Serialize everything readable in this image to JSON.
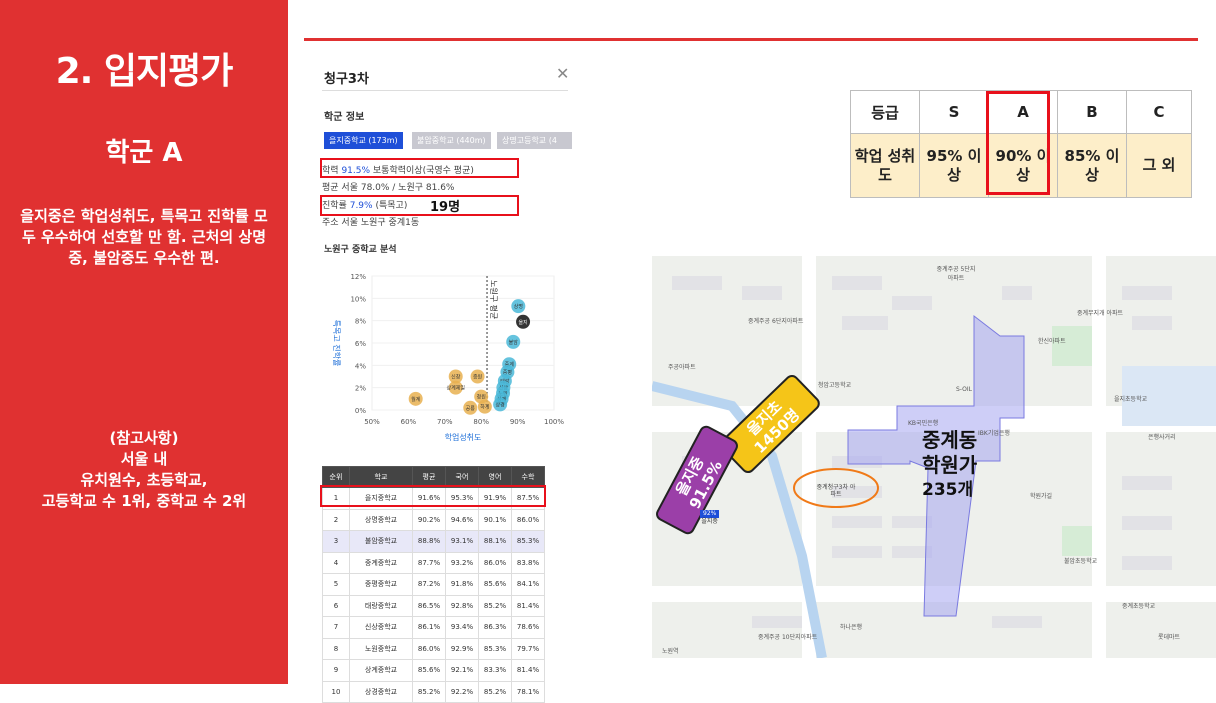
{
  "left": {
    "title": "2. 입지평가",
    "subtitle": "학군 A",
    "desc": "을지중은 학업성취도, 특목고 진학률 모두 우수하여 선호할 만 함. 근처의 상명중, 불암중도 우수한 편.",
    "ref_title": "(참고사항)",
    "ref_lines": [
      "서울 내",
      "유치원수, 초등학교,",
      "고등학교 수 1위, 중학교 수 2위"
    ]
  },
  "colors": {
    "accent_red": "#e03131",
    "tab_blue": "#1e4fd8",
    "highlight_red": "#e8101b",
    "cream": "#fdeec9",
    "purple": "#9b3fa8",
    "yellow": "#f5c518",
    "academy_zone": "#a6a6f0"
  },
  "panel": {
    "title": "청구3차",
    "section_school": "학군 정보",
    "tabs": [
      "을지중학교 (173m)",
      "불암중학교 (440m)",
      "상명고등학교 (4"
    ],
    "achievement_label": "학력",
    "achievement_value": "91.5%",
    "achievement_suffix": "보통학력이상(국영수 평균)",
    "avg_line": "평균 서울 78.0% / 노원구 81.6%",
    "advance_label": "진학률",
    "advance_value": "7.9%",
    "advance_suffix": "(특목고)",
    "advance_note": "19명",
    "address": "주소 서울 노원구 중계1동",
    "section_analysis": "노원구 중학교 분석"
  },
  "chart_data": {
    "type": "scatter",
    "title": "",
    "xlabel": "학업성취도",
    "ylabel": "특목고 진학률",
    "xlim": [
      50,
      100
    ],
    "ylim": [
      0,
      12
    ],
    "x_ticks": [
      "50%",
      "60%",
      "70%",
      "80%",
      "90%",
      "100%"
    ],
    "y_ticks": [
      "0%",
      "2%",
      "4%",
      "6%",
      "8%",
      "10%",
      "12%"
    ],
    "reference_line": {
      "x": 81.6,
      "label": "노원구 평균"
    },
    "points": [
      {
        "label": "을지",
        "x": 91.5,
        "y": 7.9,
        "highlight": true
      },
      {
        "label": "상명",
        "x": 90.2,
        "y": 9.3
      },
      {
        "label": "불암",
        "x": 88.8,
        "y": 6.1
      },
      {
        "label": "중계",
        "x": 87.7,
        "y": 4.1
      },
      {
        "label": "중평",
        "x": 87.2,
        "y": 3.4
      },
      {
        "label": "태랑",
        "x": 86.5,
        "y": 2.6
      },
      {
        "label": "신상",
        "x": 86.1,
        "y": 2.0
      },
      {
        "label": "노원",
        "x": 86.0,
        "y": 1.5
      },
      {
        "label": "상계",
        "x": 85.6,
        "y": 1.0
      },
      {
        "label": "상경",
        "x": 85.2,
        "y": 0.5
      },
      {
        "label": "신창",
        "x": 73,
        "y": 3.0
      },
      {
        "label": "상계제일",
        "x": 73,
        "y": 2.0
      },
      {
        "label": "월계",
        "x": 62,
        "y": 1.0
      },
      {
        "label": "중원",
        "x": 79,
        "y": 3.0
      },
      {
        "label": "공릉",
        "x": 77,
        "y": 0.2
      },
      {
        "label": "청원",
        "x": 80,
        "y": 1.2
      },
      {
        "label": "하계",
        "x": 81,
        "y": 0.3
      }
    ]
  },
  "table": {
    "headers": [
      "순위",
      "학교",
      "평균",
      "국어",
      "영어",
      "수학"
    ],
    "rows": [
      [
        "1",
        "을지중학교",
        "91.6%",
        "95.3%",
        "91.9%",
        "87.5%"
      ],
      [
        "2",
        "상명중학교",
        "90.2%",
        "94.6%",
        "90.1%",
        "86.0%"
      ],
      [
        "3",
        "불암중학교",
        "88.8%",
        "93.1%",
        "88.1%",
        "85.3%"
      ],
      [
        "4",
        "중계중학교",
        "87.7%",
        "93.2%",
        "86.0%",
        "83.8%"
      ],
      [
        "5",
        "중평중학교",
        "87.2%",
        "91.8%",
        "85.6%",
        "84.1%"
      ],
      [
        "6",
        "태랑중학교",
        "86.5%",
        "92.8%",
        "85.2%",
        "81.4%"
      ],
      [
        "7",
        "신상중학교",
        "86.1%",
        "93.4%",
        "86.3%",
        "78.6%"
      ],
      [
        "8",
        "노원중학교",
        "86.0%",
        "92.9%",
        "85.3%",
        "79.7%"
      ],
      [
        "9",
        "상계중학교",
        "85.6%",
        "92.1%",
        "83.3%",
        "81.4%"
      ],
      [
        "10",
        "상경중학교",
        "85.2%",
        "92.2%",
        "85.2%",
        "78.1%"
      ]
    ]
  },
  "grade": {
    "headers": [
      "등급",
      "S",
      "A",
      "B",
      "C"
    ],
    "row_label": "학업 성취도",
    "values": [
      "95% 이상",
      "90% 이상",
      "85% 이상",
      "그 외"
    ]
  },
  "map": {
    "purple_label": "을지중",
    "purple_value": "91.5%",
    "yellow_label": "을지초",
    "yellow_value": "1450명",
    "zone_title": "중계동",
    "zone_sub": "학원가",
    "zone_count": "235개",
    "apt_label": "중계청구3차 아파트",
    "badge_pct": "92%",
    "badge_name": "을지중",
    "places": [
      "중계주공 5단지아파트",
      "중계무지개 아파트",
      "청암고등학교",
      "한신아파트",
      "을지초등학교",
      "중계주공 10단지아파트",
      "중계주공 6단지아파트",
      "하나은행",
      "노원역",
      "중계초등학교",
      "불암초등학교",
      "은행사거리",
      "학원가길",
      "S-OIL",
      "KB국민은행",
      "IBK기업은행",
      "주공아파트",
      "롯데마트"
    ]
  }
}
